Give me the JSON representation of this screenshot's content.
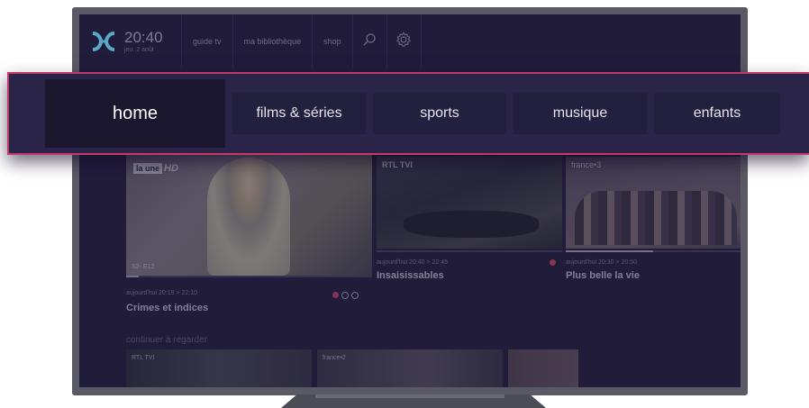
{
  "clock": {
    "time": "20:40",
    "date": "jeu. 2 août"
  },
  "top_nav": [
    {
      "label": "guide tv"
    },
    {
      "label": "ma bibliothèque"
    },
    {
      "label": "shop"
    }
  ],
  "top_icons": {
    "search": "search-icon",
    "settings": "gear-icon",
    "logo": "proximus-logo-icon"
  },
  "main_menu": [
    {
      "label": "home",
      "active": true
    },
    {
      "label": "films & séries"
    },
    {
      "label": "sports"
    },
    {
      "label": "musique"
    },
    {
      "label": "enfants"
    }
  ],
  "cards": {
    "main": {
      "channel_box": "la une",
      "channel_hd": "HD",
      "episode": "S2- E12",
      "time": "aujourd'hui  20:19 > 22:10",
      "title": "Crimes et indices",
      "progress": 0.05
    },
    "rtl": {
      "channel": "RTL TVI",
      "time": "aujourd'hui  20:40 > 22:45",
      "title": "Insaisissables",
      "progress": 0.0
    },
    "france3": {
      "channel": "france•3",
      "time": "aujourd'hui  20:30 > 20:50",
      "title": "Plus belle la vie",
      "progress": 0.5
    }
  },
  "continue_section": {
    "title": "continuer à regarder",
    "items": [
      {
        "channel": "RTL TVI"
      },
      {
        "channel": "france•2"
      },
      {
        "channel": ""
      }
    ]
  },
  "colors": {
    "accent": "#c33a6a",
    "screen_bg": "#201c3a",
    "record": "#e0456b"
  }
}
